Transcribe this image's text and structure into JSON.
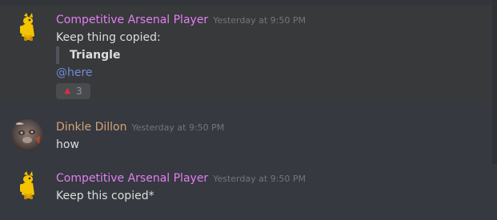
{
  "messages": [
    {
      "author": "Competitive Arsenal Player",
      "author_color": "#e27ff3",
      "timestamp": "Yesterday at 9:50 PM",
      "avatar": "yellow-mascot-icon",
      "lines": [
        "Keep thing copied:"
      ],
      "quote": "Triangle",
      "mention": "@here",
      "reaction": {
        "emoji": "up-triangle-icon",
        "glyph": "▲",
        "count": "3"
      }
    },
    {
      "author": "Dinkle Dillon",
      "author_color": "#d4a27a",
      "timestamp": "Yesterday at 9:50 PM",
      "avatar": "animal-photo-icon",
      "lines": [
        "how"
      ]
    },
    {
      "author": "Competitive Arsenal Player",
      "author_color": "#e27ff3",
      "timestamp": "Yesterday at 9:50 PM",
      "avatar": "yellow-mascot-icon",
      "lines": [
        "Keep this copied*"
      ]
    }
  ]
}
